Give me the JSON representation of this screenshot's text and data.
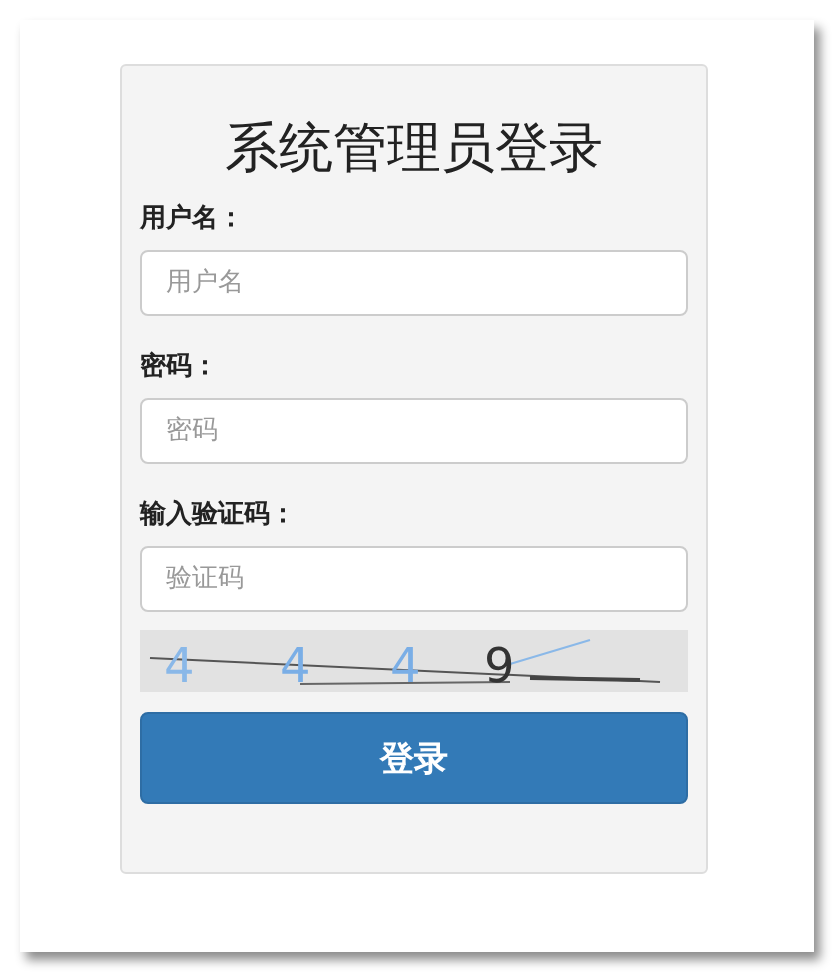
{
  "title": "系统管理员登录",
  "fields": [
    {
      "label": "用户名：",
      "placeholder": "用户名"
    },
    {
      "label": "密码：",
      "placeholder": "密码"
    },
    {
      "label": "输入验证码：",
      "placeholder": "验证码"
    }
  ],
  "captcha": {
    "characters": [
      {
        "text": "4",
        "color": "#8ab8e8"
      },
      {
        "text": "4",
        "color": "#7aaee6"
      },
      {
        "text": "4",
        "color": "#7aaee6"
      },
      {
        "text": "9",
        "color": "#333333"
      }
    ]
  },
  "button": "登录"
}
